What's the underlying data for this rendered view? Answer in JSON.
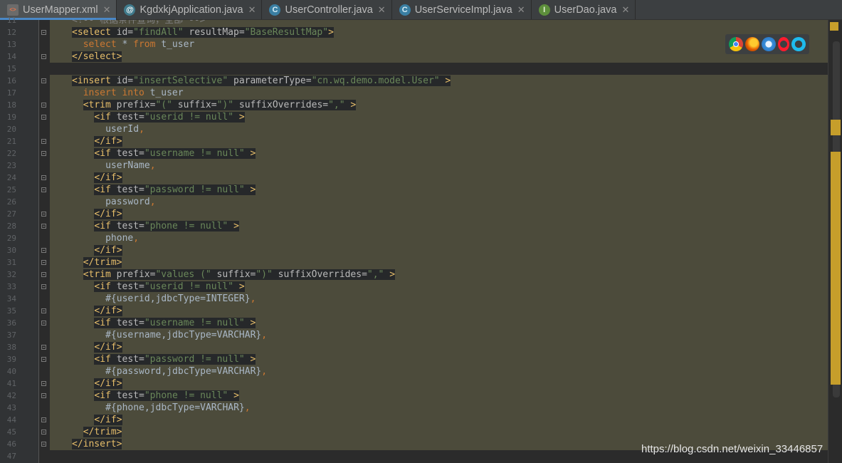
{
  "tabs": [
    {
      "label": "UserMapper.xml",
      "icon": "xml-file-icon",
      "active": true
    },
    {
      "label": "KgdxkjApplication.java",
      "icon": "spring-boot-app-icon",
      "active": false
    },
    {
      "label": "UserController.java",
      "icon": "class-icon",
      "active": false
    },
    {
      "label": "UserServiceImpl.java",
      "icon": "class-icon",
      "active": false
    },
    {
      "label": "UserDao.java",
      "icon": "interface-icon",
      "active": false
    }
  ],
  "tab_icon_glyphs": {
    "xml": "<>",
    "spring": "@",
    "class": "C",
    "iface": "I"
  },
  "tab_close_glyph": "✕",
  "line_numbers": [
    "11",
    "12",
    "13",
    "14",
    "15",
    "16",
    "17",
    "18",
    "19",
    "20",
    "21",
    "22",
    "23",
    "24",
    "25",
    "26",
    "27",
    "28",
    "29",
    "30",
    "31",
    "32",
    "33",
    "34",
    "35",
    "36",
    "37",
    "38",
    "39",
    "40",
    "41",
    "42",
    "43",
    "44",
    "45",
    "46",
    "47"
  ],
  "code": [
    {
      "segs": [
        [
          "c",
          "<!-- 根据条件查询，全部 -->"
        ]
      ]
    },
    {
      "segs": [
        [
          "t",
          "<select "
        ],
        [
          "a",
          "id="
        ],
        [
          "v",
          "\"findAll\""
        ],
        [
          "a",
          " resultMap="
        ],
        [
          "v",
          "\"BaseResultMap\""
        ],
        [
          "t",
          ">"
        ]
      ]
    },
    {
      "segs": [
        [
          "k",
          "select "
        ],
        [
          "p",
          "* "
        ],
        [
          "k",
          "from "
        ],
        [
          "p",
          "t_user"
        ]
      ]
    },
    {
      "segs": [
        [
          "t",
          "</select>"
        ]
      ]
    },
    {
      "segs": []
    },
    {
      "segs": [
        [
          "t",
          "<insert "
        ],
        [
          "a",
          "id="
        ],
        [
          "v",
          "\"insertSelective\""
        ],
        [
          "a",
          " parameterType="
        ],
        [
          "v",
          "\"cn.wq.demo.model.User\""
        ],
        [
          "t",
          " >"
        ]
      ]
    },
    {
      "segs": [
        [
          "k",
          "insert into "
        ],
        [
          "p",
          "t_user"
        ]
      ]
    },
    {
      "segs": [
        [
          "t",
          "<trim "
        ],
        [
          "a",
          "prefix="
        ],
        [
          "v",
          "\"(\""
        ],
        [
          "a",
          " suffix="
        ],
        [
          "v",
          "\")\""
        ],
        [
          "a",
          " suffixOverrides="
        ],
        [
          "v",
          "\",\""
        ],
        [
          "t",
          " >"
        ]
      ]
    },
    {
      "segs": [
        [
          "t",
          "<if "
        ],
        [
          "a",
          "test="
        ],
        [
          "v",
          "\"userid != null\""
        ],
        [
          "t",
          " >"
        ]
      ]
    },
    {
      "segs": [
        [
          "p",
          "userId"
        ],
        [
          "cm",
          ","
        ]
      ]
    },
    {
      "segs": [
        [
          "t",
          "</if>"
        ]
      ]
    },
    {
      "segs": [
        [
          "t",
          "<if "
        ],
        [
          "a",
          "test="
        ],
        [
          "v",
          "\"username != null\""
        ],
        [
          "t",
          " >"
        ]
      ]
    },
    {
      "segs": [
        [
          "p",
          "userName"
        ],
        [
          "cm",
          ","
        ]
      ]
    },
    {
      "segs": [
        [
          "t",
          "</if>"
        ]
      ]
    },
    {
      "segs": [
        [
          "t",
          "<if "
        ],
        [
          "a",
          "test="
        ],
        [
          "v",
          "\"password != null\""
        ],
        [
          "t",
          " >"
        ]
      ]
    },
    {
      "segs": [
        [
          "p",
          "password"
        ],
        [
          "cm",
          ","
        ]
      ]
    },
    {
      "segs": [
        [
          "t",
          "</if>"
        ]
      ]
    },
    {
      "segs": [
        [
          "t",
          "<if "
        ],
        [
          "a",
          "test="
        ],
        [
          "v",
          "\"phone != null\""
        ],
        [
          "t",
          " >"
        ]
      ]
    },
    {
      "segs": [
        [
          "p",
          "phone"
        ],
        [
          "cm",
          ","
        ]
      ]
    },
    {
      "segs": [
        [
          "t",
          "</if>"
        ]
      ]
    },
    {
      "segs": [
        [
          "t",
          "</trim>"
        ]
      ]
    },
    {
      "segs": [
        [
          "t",
          "<trim "
        ],
        [
          "a",
          "prefix="
        ],
        [
          "v",
          "\"values (\""
        ],
        [
          "a",
          " suffix="
        ],
        [
          "v",
          "\")\""
        ],
        [
          "a",
          " suffixOverrides="
        ],
        [
          "v",
          "\",\""
        ],
        [
          "t",
          " >"
        ]
      ]
    },
    {
      "segs": [
        [
          "t",
          "<if "
        ],
        [
          "a",
          "test="
        ],
        [
          "v",
          "\"userid != null\""
        ],
        [
          "t",
          " >"
        ]
      ]
    },
    {
      "segs": [
        [
          "p",
          "#{userid,jdbcType=INTEGER}"
        ],
        [
          "cm",
          ","
        ]
      ]
    },
    {
      "segs": [
        [
          "t",
          "</if>"
        ]
      ]
    },
    {
      "segs": [
        [
          "t",
          "<if "
        ],
        [
          "a",
          "test="
        ],
        [
          "v",
          "\"username != null\""
        ],
        [
          "t",
          " >"
        ]
      ]
    },
    {
      "segs": [
        [
          "p",
          "#{username,jdbcType=VARCHAR}"
        ],
        [
          "cm",
          ","
        ]
      ]
    },
    {
      "segs": [
        [
          "t",
          "</if>"
        ]
      ]
    },
    {
      "segs": [
        [
          "t",
          "<if "
        ],
        [
          "a",
          "test="
        ],
        [
          "v",
          "\"password != null\""
        ],
        [
          "t",
          " >"
        ]
      ]
    },
    {
      "segs": [
        [
          "p",
          "#{password,jdbcType=VARCHAR}"
        ],
        [
          "cm",
          ","
        ]
      ]
    },
    {
      "segs": [
        [
          "t",
          "</if>"
        ]
      ]
    },
    {
      "segs": [
        [
          "t",
          "<if "
        ],
        [
          "a",
          "test="
        ],
        [
          "v",
          "\"phone != null\""
        ],
        [
          "t",
          " >"
        ]
      ]
    },
    {
      "segs": [
        [
          "p",
          "#{phone,jdbcType=VARCHAR}"
        ],
        [
          "cm",
          ","
        ]
      ]
    },
    {
      "segs": [
        [
          "t",
          "</if>"
        ]
      ]
    },
    {
      "segs": [
        [
          "t",
          "</trim>"
        ]
      ]
    },
    {
      "segs": [
        [
          "t",
          "</insert>"
        ]
      ]
    },
    {
      "segs": []
    }
  ],
  "browser_icons": [
    "chrome-icon",
    "firefox-icon",
    "safari-icon",
    "opera-icon",
    "ie-icon"
  ],
  "watermark": "https://blog.csdn.net/weixin_33446857",
  "colors": {
    "background": "#2b2b2b",
    "gutter": "#313335",
    "selection_highlight": "#4c4b3b",
    "xml_tag": "#e8bf6a",
    "attribute": "#bababa",
    "string": "#6a8759",
    "keyword": "#cc7832",
    "comment": "#808080",
    "active_tab_underline": "#4a88c7",
    "marker": "#c69e2b"
  }
}
